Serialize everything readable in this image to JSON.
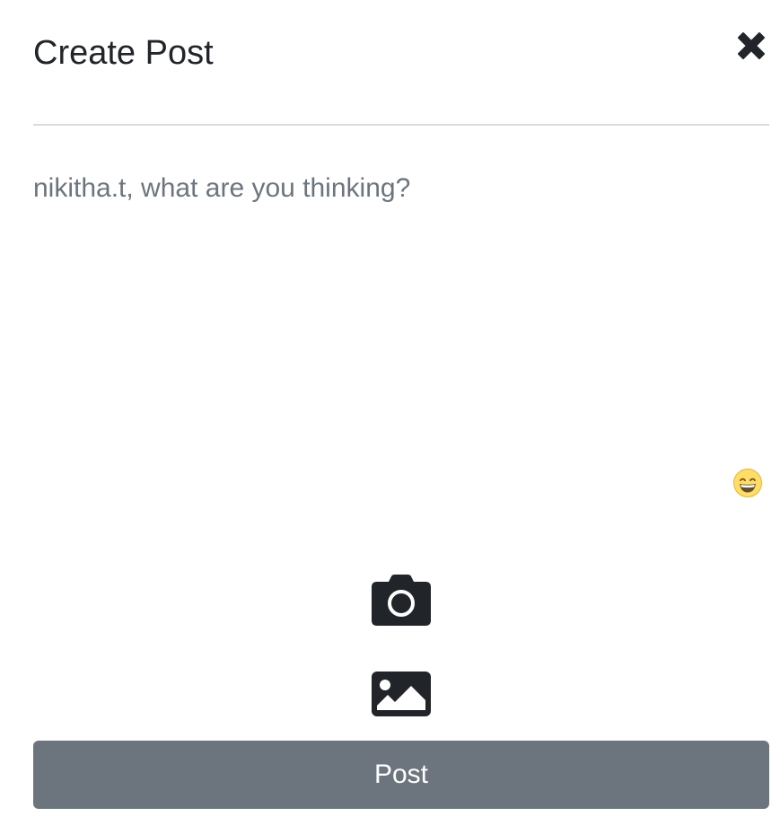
{
  "header": {
    "title": "Create Post",
    "close_icon": "close-icon"
  },
  "composer": {
    "placeholder": "nikitha.t, what are you thinking?",
    "value": ""
  },
  "emoji": {
    "icon": "grinning-face-emoji-icon"
  },
  "media": {
    "camera_icon": "camera-icon",
    "gallery_icon": "image-icon"
  },
  "footer": {
    "post_label": "Post"
  },
  "colors": {
    "text": "#212529",
    "placeholder": "#6c757d",
    "divider": "#d9dadc",
    "post_button": "#6c757d",
    "icon_dark": "#212529",
    "emoji_yellow": "#ffdd67"
  }
}
